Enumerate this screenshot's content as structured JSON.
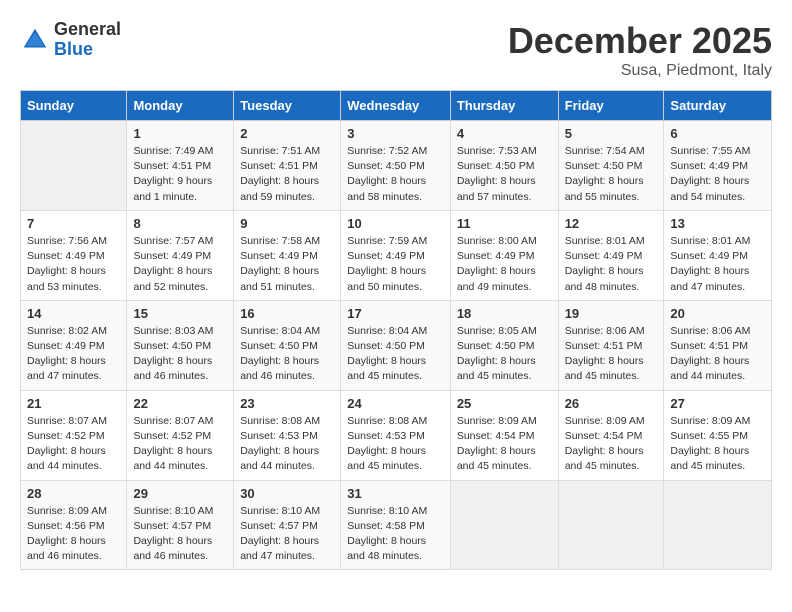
{
  "header": {
    "logo_general": "General",
    "logo_blue": "Blue",
    "month_title": "December 2025",
    "location": "Susa, Piedmont, Italy"
  },
  "days_of_week": [
    "Sunday",
    "Monday",
    "Tuesday",
    "Wednesday",
    "Thursday",
    "Friday",
    "Saturday"
  ],
  "weeks": [
    [
      {
        "day": "",
        "info": ""
      },
      {
        "day": "1",
        "info": "Sunrise: 7:49 AM\nSunset: 4:51 PM\nDaylight: 9 hours\nand 1 minute."
      },
      {
        "day": "2",
        "info": "Sunrise: 7:51 AM\nSunset: 4:51 PM\nDaylight: 8 hours\nand 59 minutes."
      },
      {
        "day": "3",
        "info": "Sunrise: 7:52 AM\nSunset: 4:50 PM\nDaylight: 8 hours\nand 58 minutes."
      },
      {
        "day": "4",
        "info": "Sunrise: 7:53 AM\nSunset: 4:50 PM\nDaylight: 8 hours\nand 57 minutes."
      },
      {
        "day": "5",
        "info": "Sunrise: 7:54 AM\nSunset: 4:50 PM\nDaylight: 8 hours\nand 55 minutes."
      },
      {
        "day": "6",
        "info": "Sunrise: 7:55 AM\nSunset: 4:49 PM\nDaylight: 8 hours\nand 54 minutes."
      }
    ],
    [
      {
        "day": "7",
        "info": "Sunrise: 7:56 AM\nSunset: 4:49 PM\nDaylight: 8 hours\nand 53 minutes."
      },
      {
        "day": "8",
        "info": "Sunrise: 7:57 AM\nSunset: 4:49 PM\nDaylight: 8 hours\nand 52 minutes."
      },
      {
        "day": "9",
        "info": "Sunrise: 7:58 AM\nSunset: 4:49 PM\nDaylight: 8 hours\nand 51 minutes."
      },
      {
        "day": "10",
        "info": "Sunrise: 7:59 AM\nSunset: 4:49 PM\nDaylight: 8 hours\nand 50 minutes."
      },
      {
        "day": "11",
        "info": "Sunrise: 8:00 AM\nSunset: 4:49 PM\nDaylight: 8 hours\nand 49 minutes."
      },
      {
        "day": "12",
        "info": "Sunrise: 8:01 AM\nSunset: 4:49 PM\nDaylight: 8 hours\nand 48 minutes."
      },
      {
        "day": "13",
        "info": "Sunrise: 8:01 AM\nSunset: 4:49 PM\nDaylight: 8 hours\nand 47 minutes."
      }
    ],
    [
      {
        "day": "14",
        "info": "Sunrise: 8:02 AM\nSunset: 4:49 PM\nDaylight: 8 hours\nand 47 minutes."
      },
      {
        "day": "15",
        "info": "Sunrise: 8:03 AM\nSunset: 4:50 PM\nDaylight: 8 hours\nand 46 minutes."
      },
      {
        "day": "16",
        "info": "Sunrise: 8:04 AM\nSunset: 4:50 PM\nDaylight: 8 hours\nand 46 minutes."
      },
      {
        "day": "17",
        "info": "Sunrise: 8:04 AM\nSunset: 4:50 PM\nDaylight: 8 hours\nand 45 minutes."
      },
      {
        "day": "18",
        "info": "Sunrise: 8:05 AM\nSunset: 4:50 PM\nDaylight: 8 hours\nand 45 minutes."
      },
      {
        "day": "19",
        "info": "Sunrise: 8:06 AM\nSunset: 4:51 PM\nDaylight: 8 hours\nand 45 minutes."
      },
      {
        "day": "20",
        "info": "Sunrise: 8:06 AM\nSunset: 4:51 PM\nDaylight: 8 hours\nand 44 minutes."
      }
    ],
    [
      {
        "day": "21",
        "info": "Sunrise: 8:07 AM\nSunset: 4:52 PM\nDaylight: 8 hours\nand 44 minutes."
      },
      {
        "day": "22",
        "info": "Sunrise: 8:07 AM\nSunset: 4:52 PM\nDaylight: 8 hours\nand 44 minutes."
      },
      {
        "day": "23",
        "info": "Sunrise: 8:08 AM\nSunset: 4:53 PM\nDaylight: 8 hours\nand 44 minutes."
      },
      {
        "day": "24",
        "info": "Sunrise: 8:08 AM\nSunset: 4:53 PM\nDaylight: 8 hours\nand 45 minutes."
      },
      {
        "day": "25",
        "info": "Sunrise: 8:09 AM\nSunset: 4:54 PM\nDaylight: 8 hours\nand 45 minutes."
      },
      {
        "day": "26",
        "info": "Sunrise: 8:09 AM\nSunset: 4:54 PM\nDaylight: 8 hours\nand 45 minutes."
      },
      {
        "day": "27",
        "info": "Sunrise: 8:09 AM\nSunset: 4:55 PM\nDaylight: 8 hours\nand 45 minutes."
      }
    ],
    [
      {
        "day": "28",
        "info": "Sunrise: 8:09 AM\nSunset: 4:56 PM\nDaylight: 8 hours\nand 46 minutes."
      },
      {
        "day": "29",
        "info": "Sunrise: 8:10 AM\nSunset: 4:57 PM\nDaylight: 8 hours\nand 46 minutes."
      },
      {
        "day": "30",
        "info": "Sunrise: 8:10 AM\nSunset: 4:57 PM\nDaylight: 8 hours\nand 47 minutes."
      },
      {
        "day": "31",
        "info": "Sunrise: 8:10 AM\nSunset: 4:58 PM\nDaylight: 8 hours\nand 48 minutes."
      },
      {
        "day": "",
        "info": ""
      },
      {
        "day": "",
        "info": ""
      },
      {
        "day": "",
        "info": ""
      }
    ]
  ]
}
